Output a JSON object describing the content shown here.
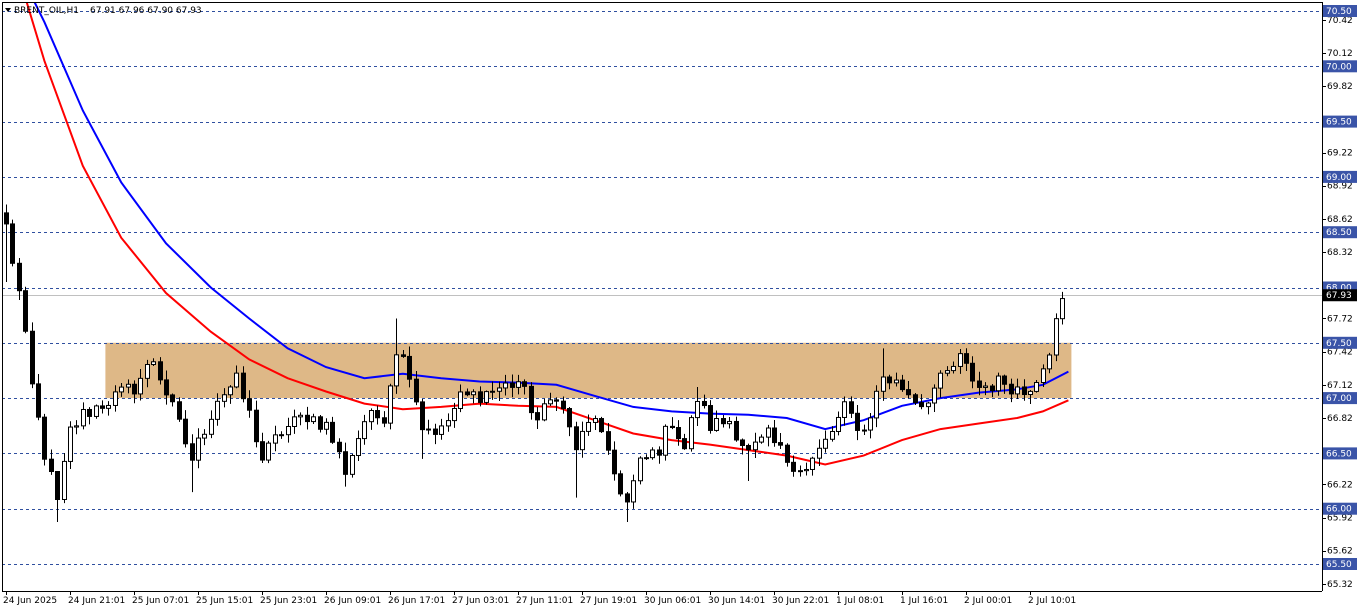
{
  "chart_title": {
    "symbol_timeframe": "BRENT_OIL,H1",
    "ohlc": "67.91 67.96 67.90 67.93"
  },
  "chart_data": {
    "type": "candlestick",
    "ylim": [
      65.25,
      70.55
    ],
    "y_ticks": [
      "70.42",
      "70.12",
      "69.82",
      "69.52",
      "69.22",
      "68.92",
      "68.62",
      "68.32",
      "68.02",
      "67.72",
      "67.42",
      "67.12",
      "66.82",
      "66.52",
      "66.22",
      "65.92",
      "65.62",
      "65.32"
    ],
    "level_lines": [
      {
        "value": 70.5,
        "label": "70.50"
      },
      {
        "value": 70.0,
        "label": "70.00"
      },
      {
        "value": 69.5,
        "label": "69.50"
      },
      {
        "value": 69.0,
        "label": "69.00"
      },
      {
        "value": 68.5,
        "label": "68.50"
      },
      {
        "value": 68.0,
        "label": "68.00"
      },
      {
        "value": 67.5,
        "label": "67.50"
      },
      {
        "value": 67.0,
        "label": "67.00"
      },
      {
        "value": 66.5,
        "label": "66.50"
      },
      {
        "value": 66.0,
        "label": "66.00"
      },
      {
        "value": 65.5,
        "label": "65.50"
      }
    ],
    "current_price": {
      "value": 67.93,
      "label": "67.93"
    },
    "zone": {
      "from": 67.0,
      "to": 67.5,
      "start_bar": 16,
      "end_bar": 166,
      "color": "#deb887"
    },
    "x_labels": [
      {
        "bar": 0,
        "label": "24 Jun 2025"
      },
      {
        "bar": 10,
        "label": "24 Jun 21:01"
      },
      {
        "bar": 20,
        "label": "25 Jun 07:01"
      },
      {
        "bar": 30,
        "label": "25 Jun 15:01"
      },
      {
        "bar": 40,
        "label": "25 Jun 23:01"
      },
      {
        "bar": 50,
        "label": "26 Jun 09:01"
      },
      {
        "bar": 60,
        "label": "26 Jun 17:01"
      },
      {
        "bar": 70,
        "label": "27 Jun 03:01"
      },
      {
        "bar": 80,
        "label": "27 Jun 11:01"
      },
      {
        "bar": 90,
        "label": "27 Jun 19:01"
      },
      {
        "bar": 100,
        "label": "30 Jun 06:01"
      },
      {
        "bar": 110,
        "label": "30 Jun 14:01"
      },
      {
        "bar": 120,
        "label": "30 Jun 22:01"
      },
      {
        "bar": 130,
        "label": "1 Jul 08:01"
      },
      {
        "bar": 140,
        "label": "1 Jul 16:01"
      },
      {
        "bar": 150,
        "label": "2 Jul 00:01"
      },
      {
        "bar": 160,
        "label": "2 Jul 10:01"
      }
    ],
    "anchors": [
      {
        "bar": 0,
        "price": 68.55,
        "high": 68.75,
        "low": 68.05
      },
      {
        "bar": 2,
        "price": 67.95
      },
      {
        "bar": 4,
        "price": 67.1
      },
      {
        "bar": 6,
        "price": 66.5
      },
      {
        "bar": 8,
        "price": 66.05,
        "high": 66.25,
        "low": 65.88
      },
      {
        "bar": 10,
        "price": 66.7
      },
      {
        "bar": 12,
        "price": 66.85
      },
      {
        "bar": 15,
        "price": 66.95
      },
      {
        "bar": 20,
        "price": 67.1
      },
      {
        "bar": 23,
        "price": 67.35
      },
      {
        "bar": 26,
        "price": 66.9
      },
      {
        "bar": 29,
        "price": 66.45,
        "low": 66.15
      },
      {
        "bar": 33,
        "price": 67.0
      },
      {
        "bar": 36,
        "price": 67.15
      },
      {
        "bar": 38,
        "price": 66.85
      },
      {
        "bar": 40,
        "price": 66.45
      },
      {
        "bar": 43,
        "price": 66.7
      },
      {
        "bar": 47,
        "price": 66.85
      },
      {
        "bar": 50,
        "price": 66.75
      },
      {
        "bar": 53,
        "price": 66.35,
        "low": 66.2
      },
      {
        "bar": 56,
        "price": 66.8
      },
      {
        "bar": 59,
        "price": 66.85
      },
      {
        "bar": 61,
        "price": 67.45,
        "high": 67.72
      },
      {
        "bar": 63,
        "price": 67.25
      },
      {
        "bar": 65,
        "price": 66.75,
        "low": 66.45
      },
      {
        "bar": 68,
        "price": 66.7
      },
      {
        "bar": 71,
        "price": 67.0
      },
      {
        "bar": 75,
        "price": 67.05
      },
      {
        "bar": 80,
        "price": 67.15
      },
      {
        "bar": 83,
        "price": 66.8
      },
      {
        "bar": 86,
        "price": 67.05
      },
      {
        "bar": 89,
        "price": 66.55,
        "low": 66.1
      },
      {
        "bar": 92,
        "price": 66.85
      },
      {
        "bar": 94,
        "price": 66.45
      },
      {
        "bar": 97,
        "price": 66.05,
        "low": 65.88
      },
      {
        "bar": 99,
        "price": 66.4
      },
      {
        "bar": 102,
        "price": 66.55
      },
      {
        "bar": 104,
        "price": 66.8
      },
      {
        "bar": 106,
        "price": 66.55
      },
      {
        "bar": 108,
        "price": 67.0,
        "high": 67.1
      },
      {
        "bar": 110,
        "price": 66.75
      },
      {
        "bar": 113,
        "price": 66.8
      },
      {
        "bar": 116,
        "price": 66.5,
        "low": 66.25
      },
      {
        "bar": 119,
        "price": 66.65
      },
      {
        "bar": 122,
        "price": 66.45
      },
      {
        "bar": 125,
        "price": 66.35,
        "low": 66.3
      },
      {
        "bar": 128,
        "price": 66.6
      },
      {
        "bar": 131,
        "price": 66.9
      },
      {
        "bar": 134,
        "price": 66.7
      },
      {
        "bar": 137,
        "price": 67.2,
        "high": 67.45
      },
      {
        "bar": 140,
        "price": 67.1
      },
      {
        "bar": 143,
        "price": 66.95
      },
      {
        "bar": 146,
        "price": 67.15
      },
      {
        "bar": 149,
        "price": 67.35
      },
      {
        "bar": 152,
        "price": 67.1
      },
      {
        "bar": 156,
        "price": 67.15
      },
      {
        "bar": 159,
        "price": 67.05
      },
      {
        "bar": 161,
        "price": 67.2
      },
      {
        "bar": 163,
        "price": 67.45
      },
      {
        "bar": 165,
        "price": 67.9,
        "high": 67.96
      }
    ],
    "series": [
      {
        "color": "#0000ff",
        "points": [
          {
            "bar": 0,
            "value": 71.1
          },
          {
            "bar": 6,
            "value": 70.4
          },
          {
            "bar": 12,
            "value": 69.6
          },
          {
            "bar": 18,
            "value": 68.95
          },
          {
            "bar": 25,
            "value": 68.4
          },
          {
            "bar": 32,
            "value": 68.0
          },
          {
            "bar": 38,
            "value": 67.72
          },
          {
            "bar": 44,
            "value": 67.45
          },
          {
            "bar": 50,
            "value": 67.28
          },
          {
            "bar": 56,
            "value": 67.18
          },
          {
            "bar": 62,
            "value": 67.22
          },
          {
            "bar": 68,
            "value": 67.18
          },
          {
            "bar": 74,
            "value": 67.15
          },
          {
            "bar": 80,
            "value": 67.14
          },
          {
            "bar": 86,
            "value": 67.12
          },
          {
            "bar": 92,
            "value": 67.02
          },
          {
            "bar": 98,
            "value": 66.92
          },
          {
            "bar": 104,
            "value": 66.88
          },
          {
            "bar": 110,
            "value": 66.86
          },
          {
            "bar": 116,
            "value": 66.85
          },
          {
            "bar": 122,
            "value": 66.82
          },
          {
            "bar": 128,
            "value": 66.72
          },
          {
            "bar": 134,
            "value": 66.8
          },
          {
            "bar": 140,
            "value": 66.93
          },
          {
            "bar": 146,
            "value": 67.0
          },
          {
            "bar": 152,
            "value": 67.05
          },
          {
            "bar": 158,
            "value": 67.08
          },
          {
            "bar": 162,
            "value": 67.12
          },
          {
            "bar": 166,
            "value": 67.24
          }
        ]
      },
      {
        "color": "#ff0000",
        "points": [
          {
            "bar": 0,
            "value": 71.2
          },
          {
            "bar": 6,
            "value": 70.05
          },
          {
            "bar": 12,
            "value": 69.1
          },
          {
            "bar": 18,
            "value": 68.45
          },
          {
            "bar": 25,
            "value": 67.95
          },
          {
            "bar": 32,
            "value": 67.6
          },
          {
            "bar": 38,
            "value": 67.35
          },
          {
            "bar": 44,
            "value": 67.18
          },
          {
            "bar": 50,
            "value": 67.06
          },
          {
            "bar": 56,
            "value": 66.95
          },
          {
            "bar": 62,
            "value": 66.9
          },
          {
            "bar": 68,
            "value": 66.92
          },
          {
            "bar": 74,
            "value": 66.95
          },
          {
            "bar": 80,
            "value": 66.93
          },
          {
            "bar": 86,
            "value": 66.92
          },
          {
            "bar": 92,
            "value": 66.8
          },
          {
            "bar": 98,
            "value": 66.68
          },
          {
            "bar": 104,
            "value": 66.62
          },
          {
            "bar": 110,
            "value": 66.58
          },
          {
            "bar": 116,
            "value": 66.53
          },
          {
            "bar": 122,
            "value": 66.48
          },
          {
            "bar": 128,
            "value": 66.4
          },
          {
            "bar": 134,
            "value": 66.48
          },
          {
            "bar": 140,
            "value": 66.62
          },
          {
            "bar": 146,
            "value": 66.72
          },
          {
            "bar": 152,
            "value": 66.77
          },
          {
            "bar": 158,
            "value": 66.82
          },
          {
            "bar": 162,
            "value": 66.88
          },
          {
            "bar": 166,
            "value": 66.98
          }
        ]
      }
    ],
    "total_bars": 167
  },
  "colors": {
    "background": "#ffffff",
    "level_line": "#2f4f9f",
    "badge": "#3a54a8",
    "current_badge": "#000000",
    "candle_up": "#ffffff",
    "candle_down": "#000000",
    "candle_outline": "#000000",
    "axis": "#000000"
  }
}
